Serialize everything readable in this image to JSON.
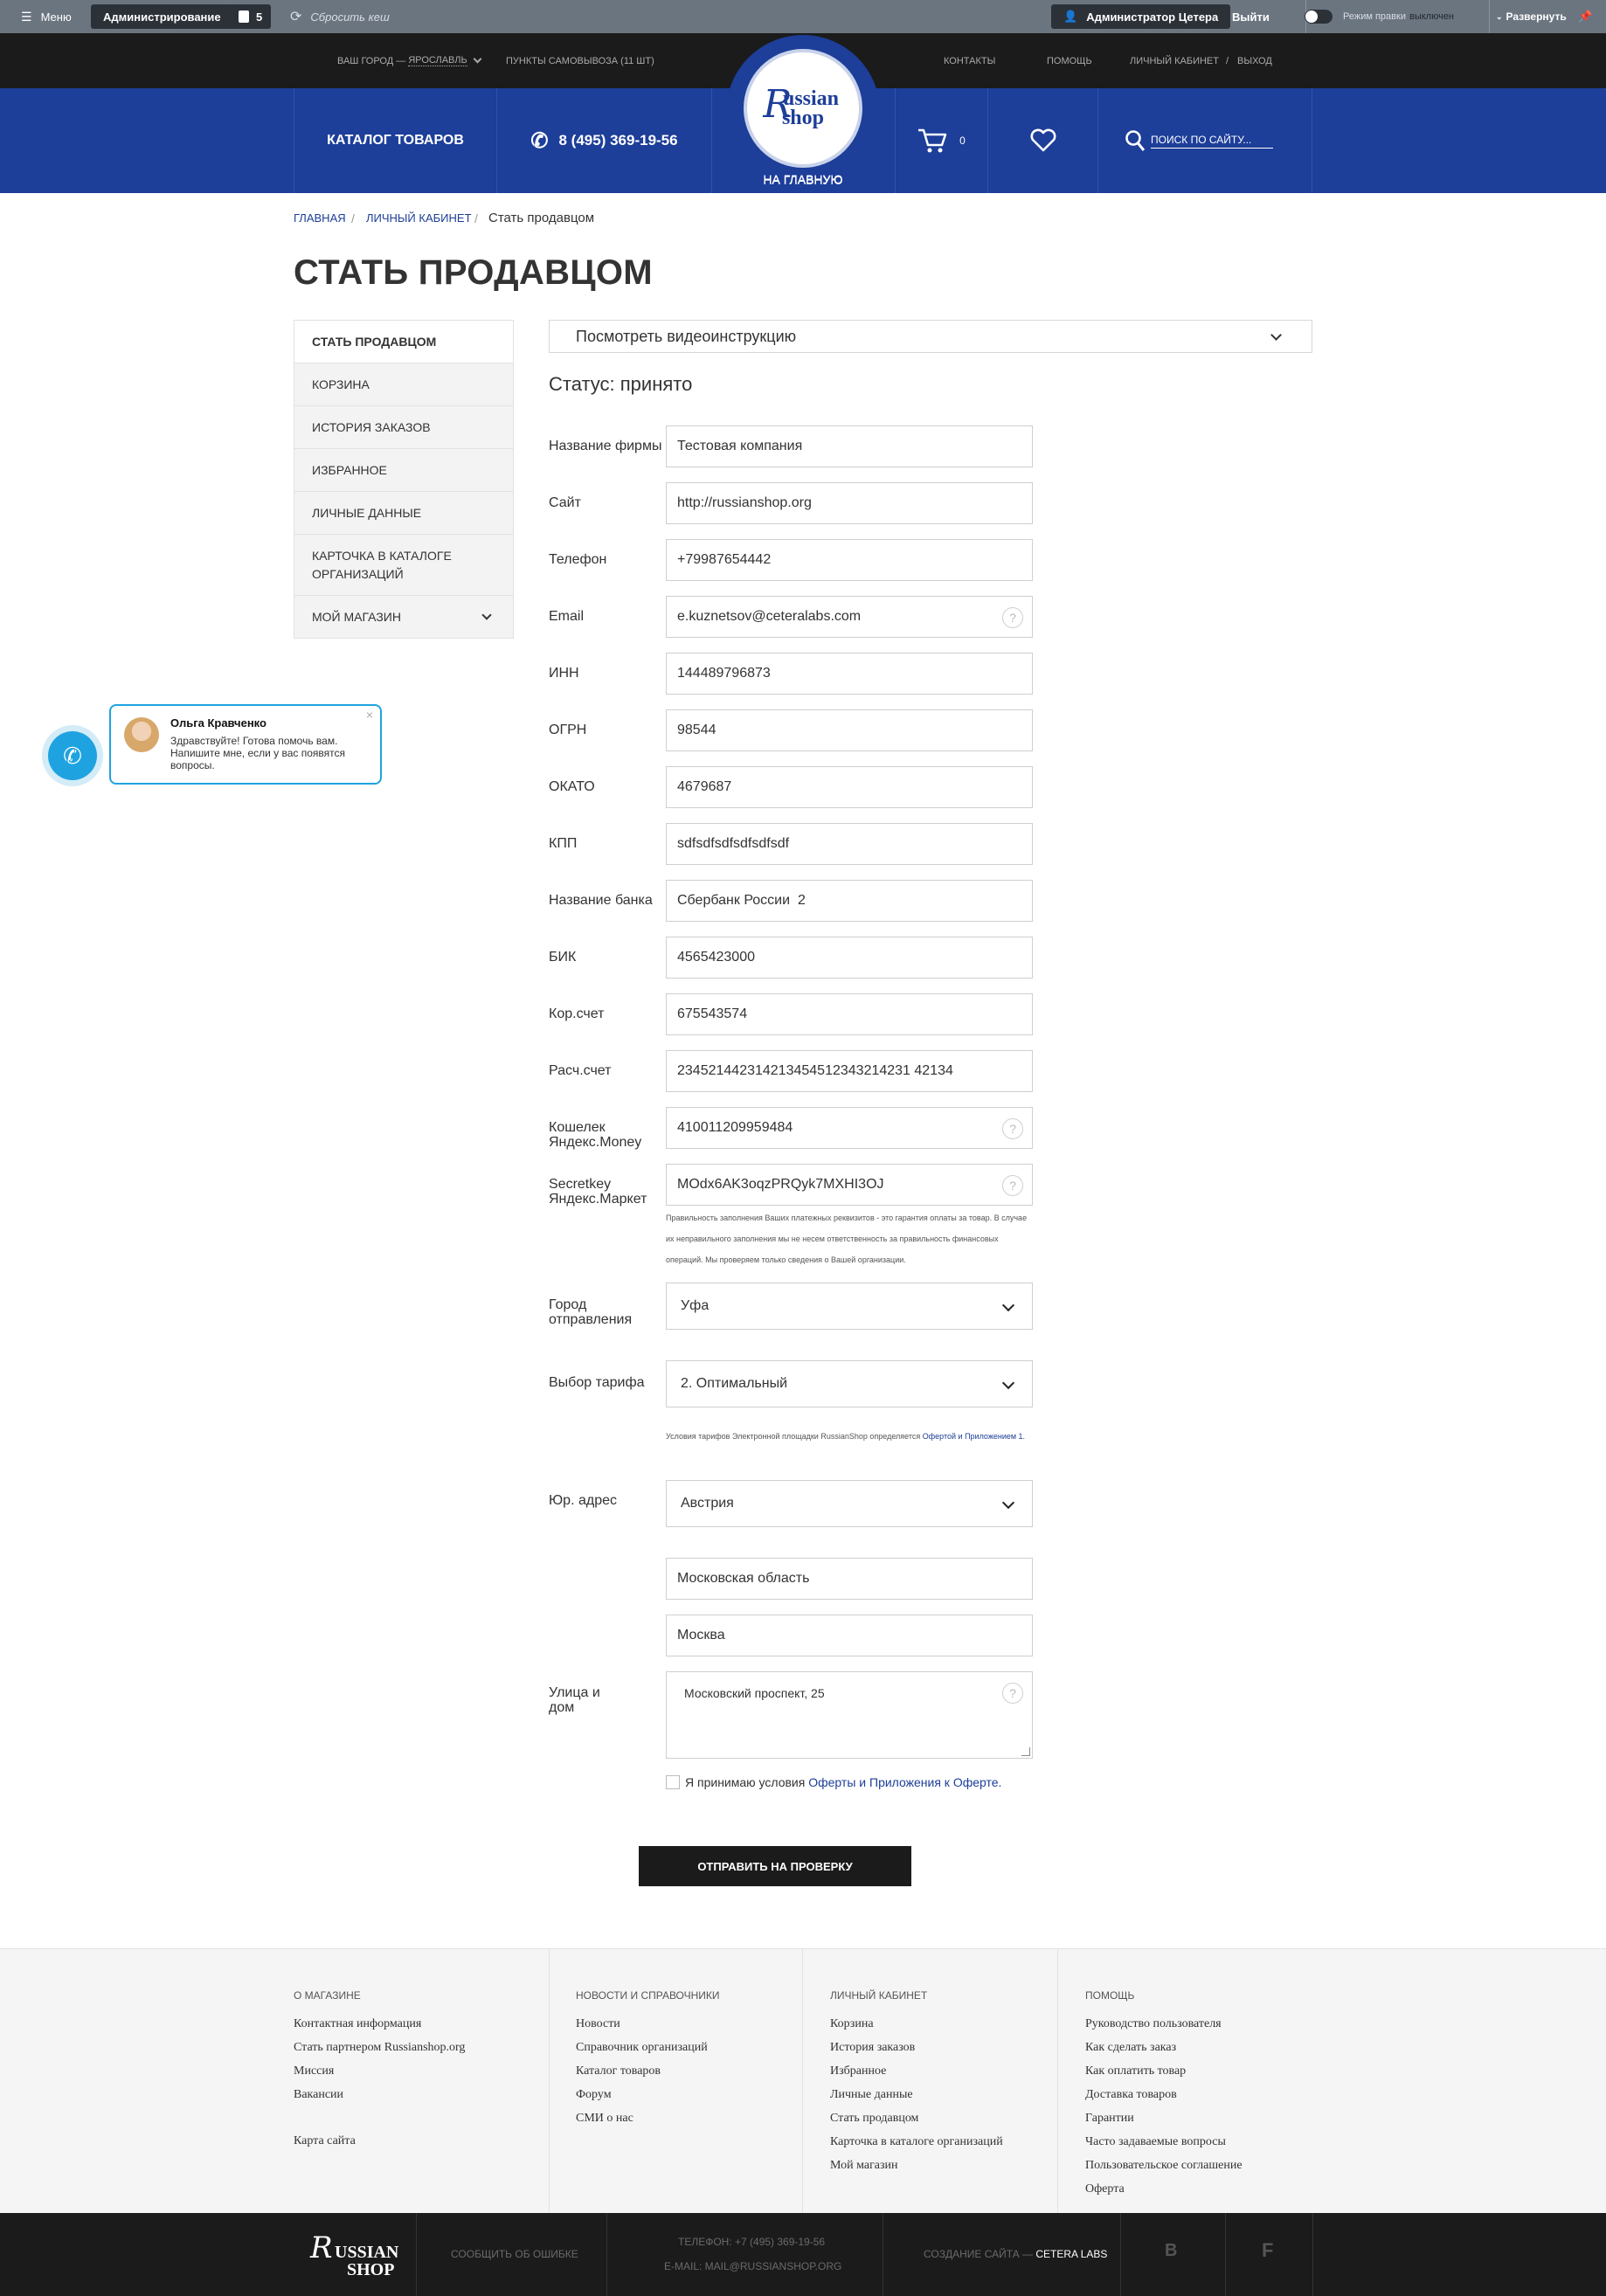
{
  "admin_bar": {
    "menu": "Меню",
    "administration": "Администрирование",
    "notifications_count": "5",
    "reset_cache": "Сбросить кеш",
    "user": "Администратор Цетера",
    "logout": "Выйти",
    "edit_mode_label": "Режим правки",
    "edit_mode_state": "выключен",
    "expand": "Развернуть"
  },
  "top_bar": {
    "city_prefix": "Ваш город —",
    "city": "Ярославль",
    "pickup": "Пункты самовывоза (11 шт)",
    "links": [
      "Контакты",
      "Помощь",
      "Личный кабинет",
      "Выход"
    ]
  },
  "header": {
    "catalog": "Каталог товаров",
    "phone": "8 (495) 369-19-56",
    "logo_line1": "ussian",
    "logo_line2": "shop",
    "home_label": "На главную",
    "cart_count": "0",
    "search_placeholder": "Поиск по сайту..."
  },
  "breadcrumbs": [
    "Главная",
    "Личный кабинет",
    "Стать продавцом"
  ],
  "page_title": "Стать продавцом",
  "sidebar": [
    {
      "label": "Стать продавцом"
    },
    {
      "label": "Корзина"
    },
    {
      "label": "История заказов"
    },
    {
      "label": "Избранное"
    },
    {
      "label": "Личные данные"
    },
    {
      "label": "Карточка в каталоге организаций"
    },
    {
      "label": "Мой магазин"
    }
  ],
  "chat": {
    "name": "Ольга Кравченко",
    "message": "Здравствуйте! Готова помочь вам. Напишите мне, если у вас появятся вопросы."
  },
  "video_instruction": "Посмотреть видеоинструкцию",
  "status": "Статус: принято",
  "form": {
    "fields": [
      {
        "label": "Название фирмы",
        "value": "Тестовая компания"
      },
      {
        "label": "Сайт",
        "value": "http://russianshop.org"
      },
      {
        "label": "Телефон",
        "value": "+79987654442"
      },
      {
        "label": "Email",
        "value": "e.kuznetsov@ceteralabs.com"
      },
      {
        "label": "ИНН",
        "value": "144489796873"
      },
      {
        "label": "ОГРН",
        "value": "98544"
      },
      {
        "label": "ОКАТО",
        "value": "4679687"
      },
      {
        "label": "КПП",
        "value": "sdfsdfsdfsdfsdfsdf"
      },
      {
        "label": "Название банка",
        "value": "Сбербанк России  2"
      },
      {
        "label": "БИК",
        "value": "4565423000"
      },
      {
        "label": "Кор.счет",
        "value": "675543574"
      },
      {
        "label": "Расч.счет",
        "value": "234521442314213454512343214231 42134"
      },
      {
        "label": "Кошелек Яндекс.Money",
        "value": "410011209959484"
      },
      {
        "label": "Secretkey Яндекс.Маркет",
        "value": "MOdx6AK3oqzPRQyk7MXHI3OJ"
      }
    ],
    "payment_note": "Правильность заполнения Ваших платежных реквизитов - это гарантия оплаты за товар. В случае их неправильного заполнения мы не несем ответственность за правильность финансовых операций. Мы проверяем только сведения о Вашей организации.",
    "ship_city_label": "Город отправления",
    "ship_city": "Уфа",
    "tariff_label": "Выбор тарифа",
    "tariff": "2. Оптимальный",
    "tariff_note_prefix": "Условия тарифов Электронной площадки RussianShop определяется",
    "tariff_note_link": "Офертой и Приложением 1.",
    "legal_address_label": "Юр. адрес",
    "country": "Австрия",
    "region": "Московская область",
    "city": "Москва",
    "street_label": "Улица и дом",
    "street": "Московский проспект, 25",
    "agree_prefix": "Я принимаю условия",
    "agree_link1": "Оферты",
    "agree_and": "и",
    "agree_link2": "Приложения к Оферте.",
    "submit": "Отправить на проверку"
  },
  "footer": {
    "columns": [
      {
        "title": "О магазине",
        "links": [
          "Контактная информация",
          "Стать партнером Russianshop.org",
          "Миссия",
          "Вакансии",
          "Карта сайта"
        ]
      },
      {
        "title": "Новости и справочники",
        "links": [
          "Новости",
          "Справочник организаций",
          "Каталог товаров",
          "Форум",
          "СМИ о нас"
        ]
      },
      {
        "title": "Личный кабинет",
        "links": [
          "Корзина",
          "История заказов",
          "Избранное",
          "Личные данные",
          "Стать продавцом",
          "Карточка в каталоге организаций",
          "Мой магазин"
        ]
      },
      {
        "title": "Помощь",
        "links": [
          "Руководство пользователя",
          "Как сделать заказ",
          "Как оплатить товар",
          "Доставка товаров",
          "Гарантии",
          "Часто задаваемые вопросы",
          "Пользовательское соглашение",
          "Оферта"
        ]
      }
    ]
  },
  "bottom_bar": {
    "logo_line1": "ussian",
    "logo_line2": "shop",
    "report_error": "Сообщить об ошибке",
    "phone": "Телефон: +7 (495) 369-19-56",
    "email": "E-mail: mail@russianshop.org",
    "created_prefix": "Создание сайта —",
    "created_by": "Cetera Labs",
    "vk": "B",
    "fb": "f"
  },
  "colors": {
    "brand_blue": "#1d3e99",
    "dark": "#1b1b1b",
    "admin_grey": "#6b7580",
    "chat_blue": "#1fa3e0"
  }
}
